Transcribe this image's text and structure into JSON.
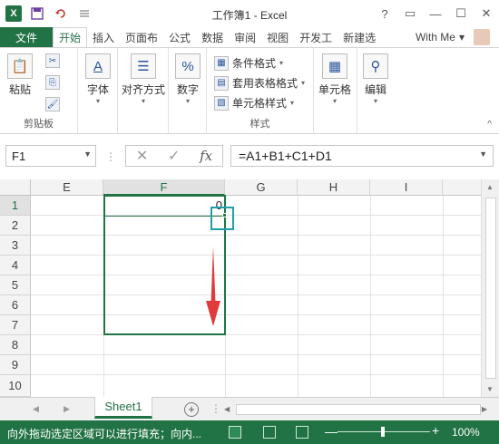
{
  "window": {
    "title": "工作簿1 - Excel",
    "help": "?",
    "restore_ribbon": "▭",
    "minimize": "—",
    "maximize": "☐",
    "close": "✕"
  },
  "qat": {
    "logo": "X",
    "save_icon": "save-icon",
    "undo_icon": "undo-icon",
    "customize_icon": "customize-icon"
  },
  "ribbon_tabs": [
    {
      "label": "文件"
    },
    {
      "label": "开始"
    },
    {
      "label": "插入"
    },
    {
      "label": "页面布"
    },
    {
      "label": "公式"
    },
    {
      "label": "数据"
    },
    {
      "label": "审阅"
    },
    {
      "label": "视图"
    },
    {
      "label": "开发工"
    },
    {
      "label": "新建选"
    }
  ],
  "account": {
    "label": "With Me",
    "caret": "▾"
  },
  "ribbon": {
    "clipboard": {
      "paste": "粘贴",
      "group": "剪贴板"
    },
    "font": {
      "label": "字体"
    },
    "alignment": {
      "label": "对齐方式"
    },
    "number": {
      "label": "数字"
    },
    "styles": {
      "conditional": "条件格式",
      "table": "套用表格格式",
      "cell_styles": "单元格样式",
      "group": "样式"
    },
    "cells": {
      "label": "单元格"
    },
    "editing": {
      "label": "编辑"
    }
  },
  "formula_bar": {
    "name_box": "F1",
    "cancel": "✕",
    "enter": "✓",
    "fx": "fx",
    "formula": "=A1+B1+C1+D1"
  },
  "grid": {
    "columns": [
      "E",
      "F",
      "G",
      "H",
      "I"
    ],
    "rows": [
      "1",
      "2",
      "3",
      "4",
      "5",
      "6",
      "7",
      "8",
      "9",
      "10"
    ],
    "active_cell": "F1",
    "active_value": "0"
  },
  "sheets": {
    "tabs": [
      "Sheet1"
    ],
    "add": "+"
  },
  "status_bar": {
    "message": "向外拖动选定区域可以进行填充；向内...",
    "zoom_minus": "—",
    "zoom_plus": "+",
    "zoom": "100%"
  },
  "colors": {
    "brand": "#217346",
    "annotation_arrow": "#e03a3a",
    "handle_box": "#1f9fa8"
  }
}
